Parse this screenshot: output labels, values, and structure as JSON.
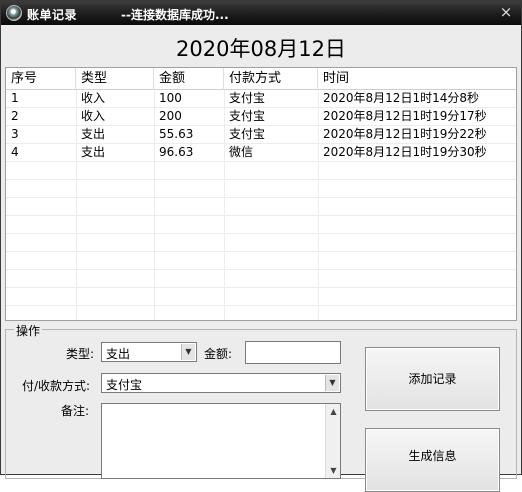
{
  "window": {
    "title": "账单记录",
    "status": "--连接数据库成功...",
    "close_glyph": "×"
  },
  "date_heading": "2020年08月12日",
  "table": {
    "columns": [
      "序号",
      "类型",
      "金额",
      "付款方式",
      "时间"
    ],
    "rows": [
      [
        "1",
        "收入",
        "100",
        "支付宝",
        "2020年8月12日1时14分8秒"
      ],
      [
        "2",
        "收入",
        "200",
        "支付宝",
        "2020年8月12日1时19分17秒"
      ],
      [
        "3",
        "支出",
        "55.63",
        "支付宝",
        "2020年8月12日1时19分22秒"
      ],
      [
        "4",
        "支出",
        "96.63",
        "微信",
        "2020年8月12日1时19分30秒"
      ]
    ]
  },
  "form": {
    "group_title": "操作",
    "type_label": "类型:",
    "type_value": "支出",
    "amount_label": "金额:",
    "amount_value": "",
    "payment_label": "付/收款方式:",
    "payment_value": "支付宝",
    "note_label": "备注:",
    "note_value": "",
    "add_button": "添加记录",
    "generate_button": "生成信息"
  },
  "icons": {
    "dropdown": "chevron-down-icon",
    "scroll_up": "scroll-up-icon",
    "scroll_down": "scroll-down-icon",
    "close": "close-icon"
  }
}
